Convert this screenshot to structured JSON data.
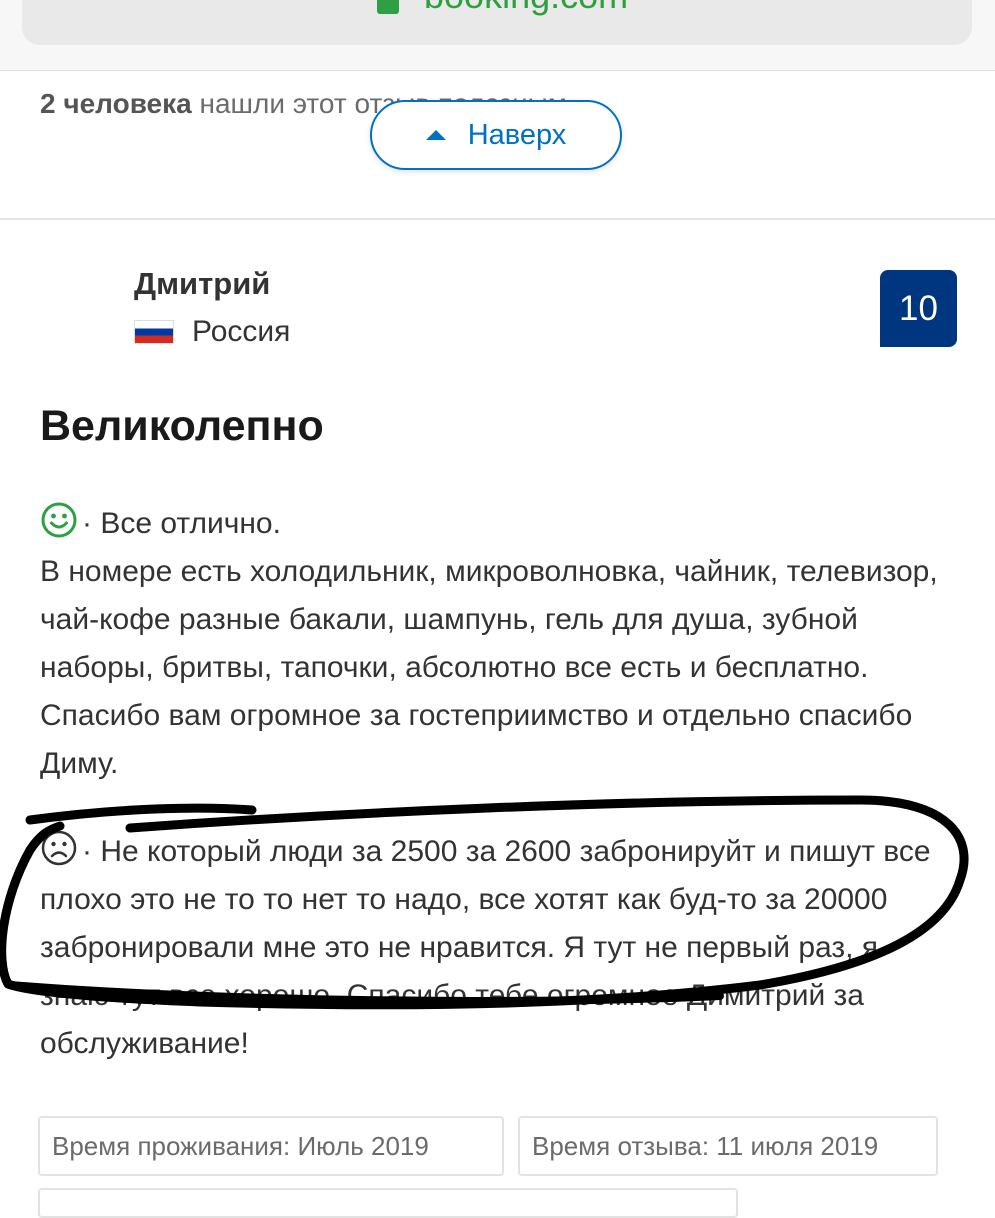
{
  "browser": {
    "url": "booking.com",
    "lock_icon": "lock-icon",
    "reload_icon": "reload-icon"
  },
  "helpful": {
    "count_text": "2 человека",
    "rest_text": "нашли этот отзыв полезным."
  },
  "back_to_top": {
    "label": "Наверх",
    "icon": "arrow-up-icon"
  },
  "reviewer": {
    "name": "Дмитрий",
    "country": "Россия",
    "flag_icon": "russia-flag-icon"
  },
  "score": "10",
  "review": {
    "title": "Великолепно",
    "positive_icon": "smile-face-icon",
    "positive_text": "· Все отлично.\nВ номере есть холодильник, микроволновка, чайник, телевизор, чай-кофе разные бакали, шампунь, гель для душа, зубной наборы, бритвы, тапочки, абсолютно все есть и бесплатно. Спасибо вам огромное за гостеприимство и отдельно спасибо Диму.",
    "negative_icon": "sad-face-icon",
    "negative_text": "· Не который люди за 2500 за 2600 забронируйт и пишут все плохо это не то то нет то надо, все хотят как буд-то за 20000 забронировали мне это не нравится. Я тут не первый раз, я знаю тут все хорошо. Спасибо тебе огромное Димитрий за обслуживание!"
  },
  "tags": {
    "stay": "Время проживания: Июль 2019",
    "review_date": "Время отзыва: 11 июля 2019"
  },
  "colors": {
    "brand_blue": "#003580",
    "link_blue": "#0071c2",
    "positive_green": "#2ea043",
    "url_green": "#2e9f3f",
    "marker": "#000000"
  }
}
